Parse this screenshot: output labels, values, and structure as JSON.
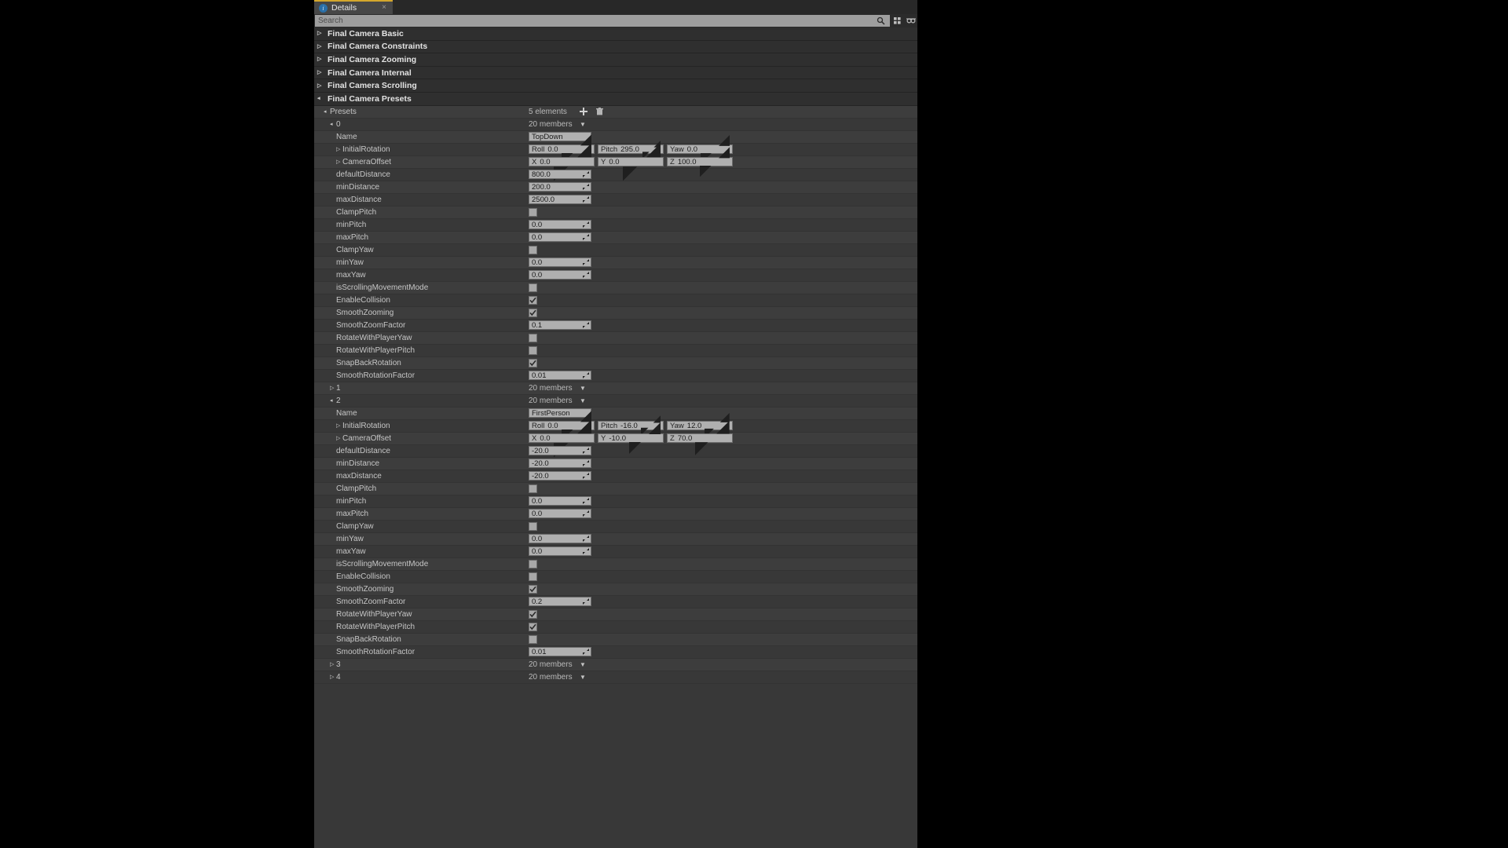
{
  "tab": {
    "label": "Details",
    "icon": "info-icon",
    "close": "×"
  },
  "search": {
    "placeholder": "Search",
    "icons": [
      "search-icon",
      "grid-view-icon",
      "settings-icon"
    ]
  },
  "categories": [
    {
      "label": "Final Camera Basic",
      "expanded": false
    },
    {
      "label": "Final Camera Constraints",
      "expanded": false
    },
    {
      "label": "Final Camera Zooming",
      "expanded": false
    },
    {
      "label": "Final Camera Internal",
      "expanded": false
    },
    {
      "label": "Final Camera Scrolling",
      "expanded": false
    },
    {
      "label": "Final Camera Presets",
      "expanded": true
    }
  ],
  "presets": {
    "label": "Presets",
    "count_label": "5 elements",
    "add_icon": "plus-icon",
    "delete_icon": "trash-icon",
    "members_label": "20 members",
    "property_labels": {
      "name": "Name",
      "initial_rotation": "InitialRotation",
      "camera_offset": "CameraOffset",
      "default_distance": "defaultDistance",
      "min_distance": "minDistance",
      "max_distance": "maxDistance",
      "clamp_pitch": "ClampPitch",
      "min_pitch": "minPitch",
      "max_pitch": "maxPitch",
      "clamp_yaw": "ClampYaw",
      "min_yaw": "minYaw",
      "max_yaw": "maxYaw",
      "is_scrolling": "isScrollingMovementMode",
      "enable_collision": "EnableCollision",
      "smooth_zooming": "SmoothZooming",
      "smooth_zoom_factor": "SmoothZoomFactor",
      "rotate_yaw": "RotateWithPlayerYaw",
      "rotate_pitch": "RotateWithPlayerPitch",
      "snap_back": "SnapBackRotation",
      "smooth_rotation_factor": "SmoothRotationFactor"
    },
    "axes": {
      "roll": "Roll",
      "pitch": "Pitch",
      "yaw": "Yaw",
      "x": "X",
      "y": "Y",
      "z": "Z"
    },
    "elements": [
      {
        "index": "0",
        "expanded": true,
        "members_label": "20 members",
        "name": "TopDown",
        "initial_rotation": {
          "roll": "0.0",
          "pitch": "295.0",
          "yaw": "0.0"
        },
        "camera_offset": {
          "x": "0.0",
          "y": "0.0",
          "z": "100.0"
        },
        "default_distance": "800.0",
        "min_distance": "200.0",
        "max_distance": "2500.0",
        "clamp_pitch": false,
        "min_pitch": "0.0",
        "max_pitch": "0.0",
        "clamp_yaw": false,
        "min_yaw": "0.0",
        "max_yaw": "0.0",
        "is_scrolling": false,
        "enable_collision": true,
        "smooth_zooming": true,
        "smooth_zoom_factor": "0.1",
        "rotate_yaw": false,
        "rotate_pitch": false,
        "snap_back": true,
        "smooth_rotation_factor": "0.01"
      },
      {
        "index": "1",
        "expanded": false,
        "members_label": "20 members"
      },
      {
        "index": "2",
        "expanded": true,
        "members_label": "20 members",
        "name": "FirstPerson",
        "initial_rotation": {
          "roll": "0.0",
          "pitch": "-16.0",
          "yaw": "12.0"
        },
        "camera_offset": {
          "x": "0.0",
          "y": "-10.0",
          "z": "70.0"
        },
        "default_distance": "-20.0",
        "min_distance": "-20.0",
        "max_distance": "-20.0",
        "clamp_pitch": false,
        "min_pitch": "0.0",
        "max_pitch": "0.0",
        "clamp_yaw": false,
        "min_yaw": "0.0",
        "max_yaw": "0.0",
        "is_scrolling": false,
        "enable_collision": false,
        "smooth_zooming": true,
        "smooth_zoom_factor": "0.2",
        "rotate_yaw": true,
        "rotate_pitch": true,
        "snap_back": false,
        "smooth_rotation_factor": "0.01"
      },
      {
        "index": "3",
        "expanded": false,
        "members_label": "20 members"
      },
      {
        "index": "4",
        "expanded": false,
        "members_label": "20 members"
      }
    ]
  },
  "colors": {
    "accent": "#d4a72c",
    "panel_bg": "#383838",
    "row_alt": "#3d3d3d",
    "field_bg": "#b0b0b0"
  }
}
